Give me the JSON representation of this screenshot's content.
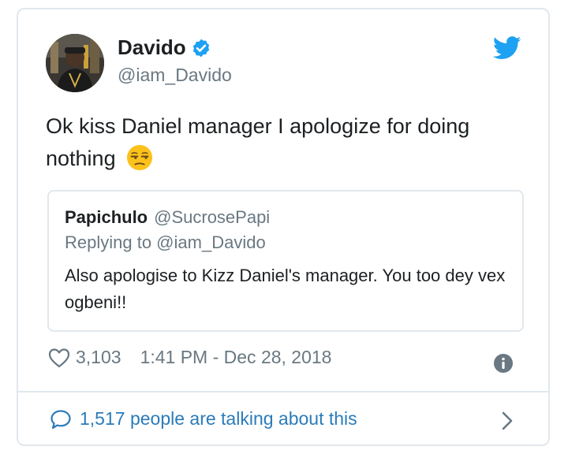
{
  "tweet": {
    "author_name": "Davido",
    "author_handle": "@iam_Davido",
    "text": "Ok kiss Daniel manager I apologize for doing nothing",
    "emoji": "unamused-face-icon",
    "verified": true
  },
  "quoted": {
    "author_name": "Papichulo",
    "author_handle": "@SucrosePapi",
    "replying_to": "Replying to @iam_Davido",
    "text": "Also apologise to Kizz Daniel's manager. You too dey vex ogbeni!!"
  },
  "meta": {
    "likes": "3,103",
    "timestamp": "1:41 PM - Dec 28, 2018"
  },
  "footer": {
    "talking": "1,517 people are talking about this"
  },
  "colors": {
    "twitter_blue": "#1da1f2",
    "link_blue": "#2b7bb9",
    "muted": "#697882",
    "border": "#e1e8ed",
    "emoji_yellow": "#fcc21b"
  }
}
